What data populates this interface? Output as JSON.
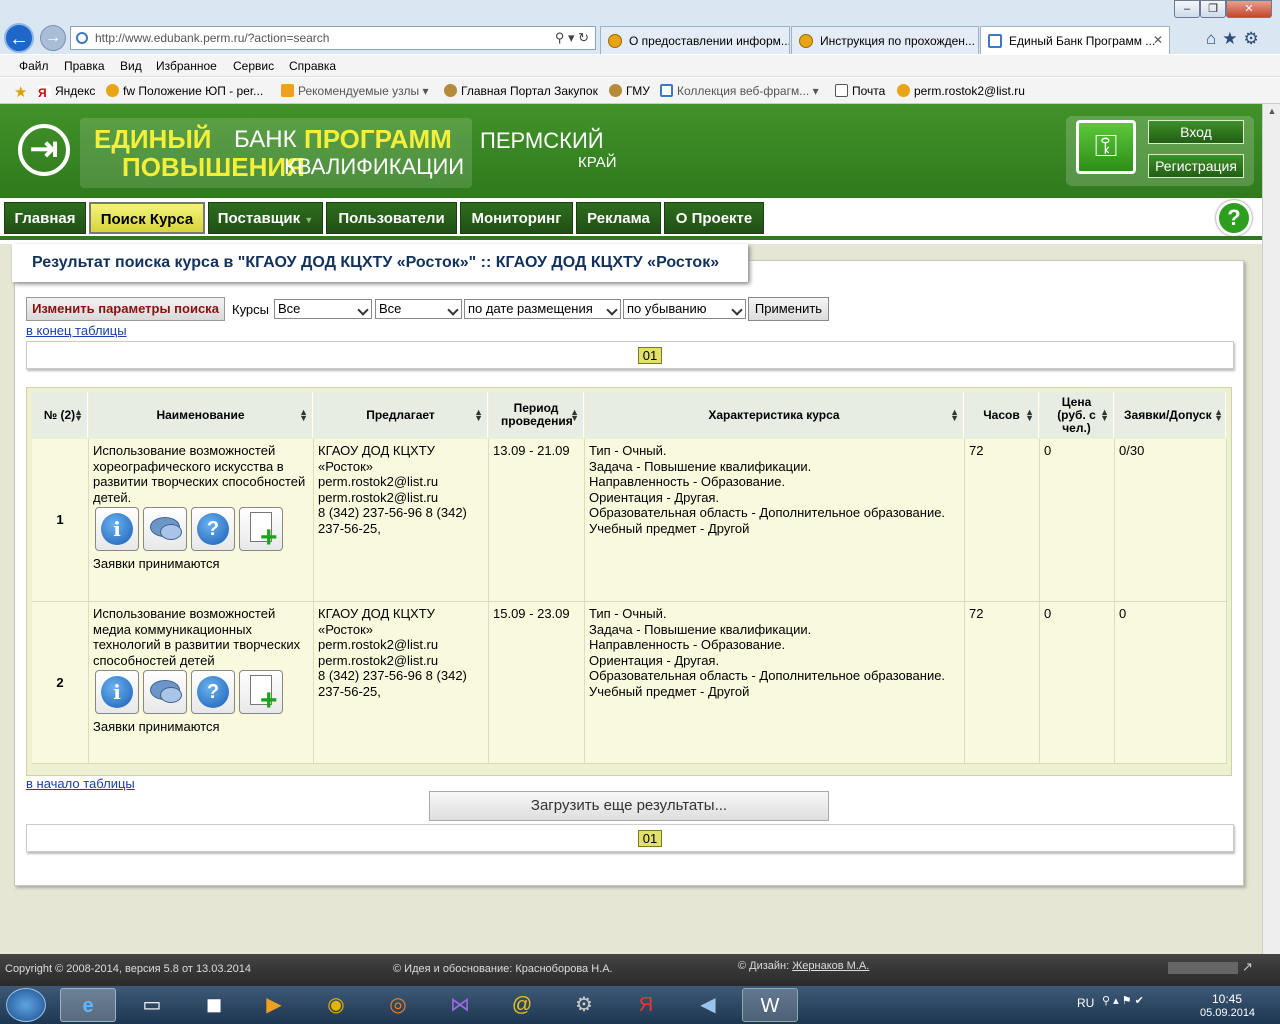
{
  "browser": {
    "url": "http://www.edubank.perm.ru/?action=search",
    "tabs": [
      {
        "label": "О предоставлении информ..."
      },
      {
        "label": "Инструкция по прохожден..."
      },
      {
        "label": "Единый Банк Программ ..."
      }
    ],
    "menu": [
      "Файл",
      "Правка",
      "Вид",
      "Избранное",
      "Сервис",
      "Справка"
    ],
    "favorites": [
      "Яндекс",
      "fw Положение ЮП - per...",
      "Рекомендуемые узлы ▾",
      "Главная Портал Закупок",
      "ГМУ",
      "Коллекция веб-фрагм... ▾",
      "Почта",
      "perm.rostok2@list.ru"
    ]
  },
  "site": {
    "logo": {
      "w1": "ЕДИНЫЙ",
      "w2": "БАНК",
      "w3": "ПРОГРАММ",
      "w4": "ПОВЫШЕНИЯ",
      "w5": "КВАЛИФИКАЦИИ"
    },
    "region": {
      "line1": "ПЕРМСКИЙ",
      "line2": "КРАЙ"
    },
    "login_label": "Вход",
    "register_label": "Регистрация",
    "nav": [
      "Главная",
      "Поиск Курса",
      "Поставщик",
      "Пользователи",
      "Мониторинг",
      "Реклама",
      "О Проекте"
    ],
    "help_symbol": "?"
  },
  "search": {
    "title": "Результат поиска курса в \"КГАОУ ДОД КЦХТУ «Росток»\" :: КГАОУ ДОД КЦХТУ «Росток»",
    "change_label": "Изменить параметры поиска",
    "courses_label": "Курсы",
    "filters": [
      "Все",
      "Все",
      "по дате размещения",
      "по убыванию"
    ],
    "apply_label": "Применить",
    "to_end": "в конец таблицы",
    "to_start": "в начало таблицы",
    "page": "01",
    "load_more": "Загрузить еще результаты..."
  },
  "table": {
    "headers": [
      "№ (2)",
      "Наименование",
      "Предлагает",
      "Период проведения",
      "Характеристика курса",
      "Часов",
      "Цена (руб. с чел.)",
      "Заявки/Допуск"
    ],
    "rows": [
      {
        "num": "1",
        "name": "Использование возможностей хореографического искусства в развитии творческих способностей детей.",
        "status": "Заявки принимаются",
        "provider": [
          "КГАОУ ДОД КЦХТУ",
          "«Росток»",
          "perm.rostok2@list.ru",
          "perm.rostok2@list.ru",
          "8 (342) 237-56-96 8 (342)",
          "237-56-25,"
        ],
        "period": "13.09 - 21.09",
        "details": [
          "Тип - Очный.",
          "Задача - Повышение квалификации.",
          "Направленность - Образование.",
          "Ориентация - Другая.",
          "Образовательная область - Дополнительное образование.",
          "Учебный предмет - Другой"
        ],
        "hours": "72",
        "price": "0",
        "requests": "0/30"
      },
      {
        "num": "2",
        "name": "Использование возможностей медиа коммуникационных технологий в развитии творческих способностей детей",
        "status": "Заявки принимаются",
        "provider": [
          "КГАОУ ДОД КЦХТУ",
          "«Росток»",
          "perm.rostok2@list.ru",
          "perm.rostok2@list.ru",
          "8 (342) 237-56-96 8 (342)",
          "237-56-25,"
        ],
        "period": "15.09 - 23.09",
        "details": [
          "Тип - Очный.",
          "Задача - Повышение квалификации.",
          "Направленность - Образование.",
          "Ориентация - Другая.",
          "Образовательная область - Дополнительное образование.",
          "Учебный предмет - Другой"
        ],
        "hours": "72",
        "price": "0",
        "requests": "0"
      }
    ]
  },
  "footer": {
    "copyright": "Copyright © 2008-2014, версия 5.8 от 13.03.2014",
    "idea": "© Идея и обоснование: Красноборова Н.А.",
    "design_prefix": "© Дизайн:",
    "design_author": "Жернаков М.А."
  },
  "taskbar": {
    "lang": "RU",
    "time": "10:45",
    "date": "05.09.2014"
  },
  "colors": {
    "header_green": "#3a8a24",
    "nav_dark": "#1f5014",
    "active_yellow": "#e6e455",
    "row_bg": "#f9f9dd"
  }
}
